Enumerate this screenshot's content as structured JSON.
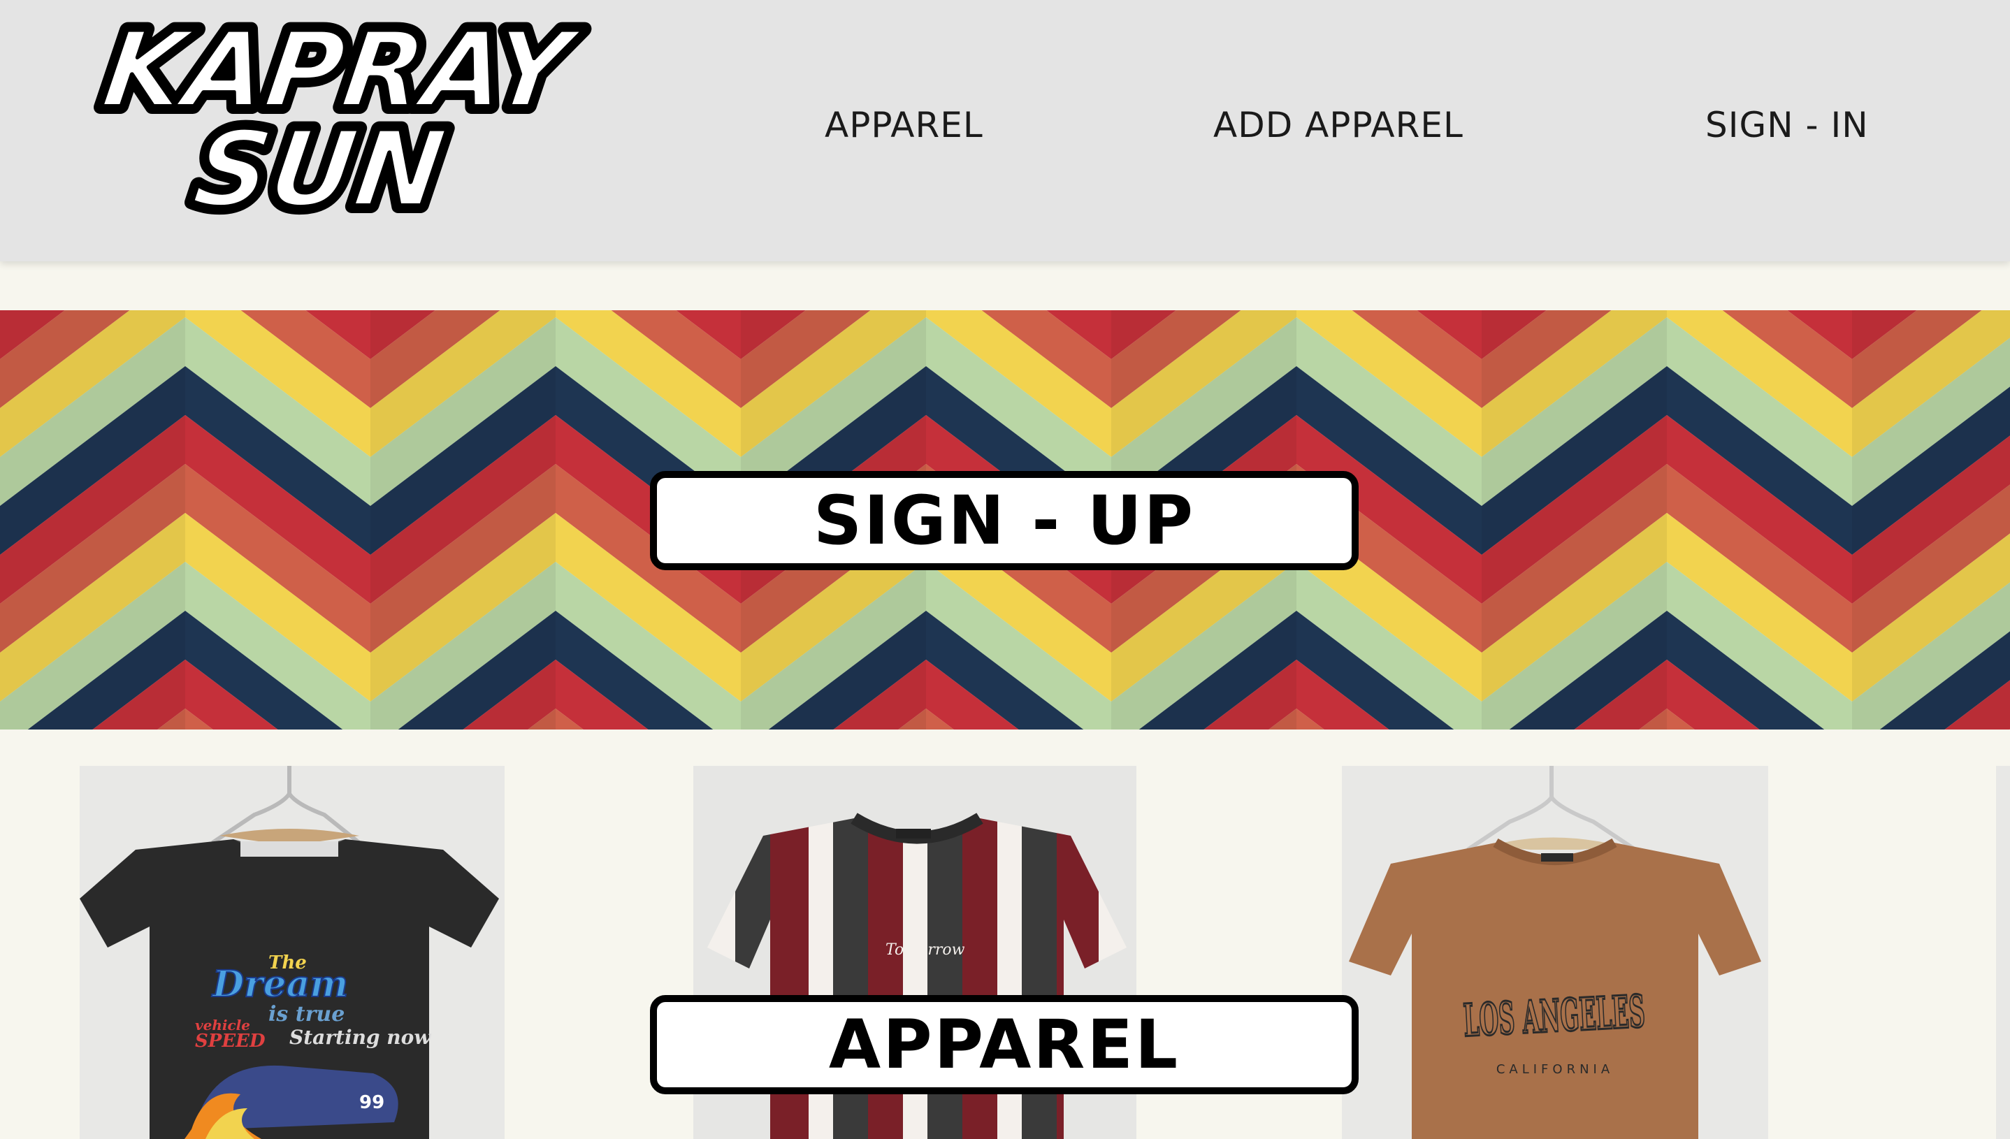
{
  "brand": {
    "logo_line1": "KAPRAY",
    "logo_line2": "SUN"
  },
  "nav": {
    "apparel": "APPAREL",
    "add_apparel": "ADD APPAREL",
    "sign_in": "SIGN - IN"
  },
  "banner": {
    "signup_label": "SIGN - UP",
    "stripe_colors": [
      "#c5303a",
      "#cf6049",
      "#f2d34f",
      "#b9d6a5",
      "#1e3552"
    ]
  },
  "products_section": {
    "apparel_label": "APPAREL"
  },
  "products": [
    {
      "shirt_color": "#2a2a2a",
      "graphic_text": [
        "The",
        "Dream",
        "is true",
        "vehicle",
        "SPEED",
        "Starting now",
        "99"
      ]
    },
    {
      "shirt_color": "#7a2028",
      "stripe_colors": [
        "#7a2028",
        "#3a3a3a",
        "#f4f0ec"
      ],
      "graphic_text": [
        "Tomorrow"
      ]
    },
    {
      "shirt_color": "#a9714a",
      "graphic_text": [
        "LOS ANGELES",
        "CALIFORNIA"
      ]
    }
  ]
}
